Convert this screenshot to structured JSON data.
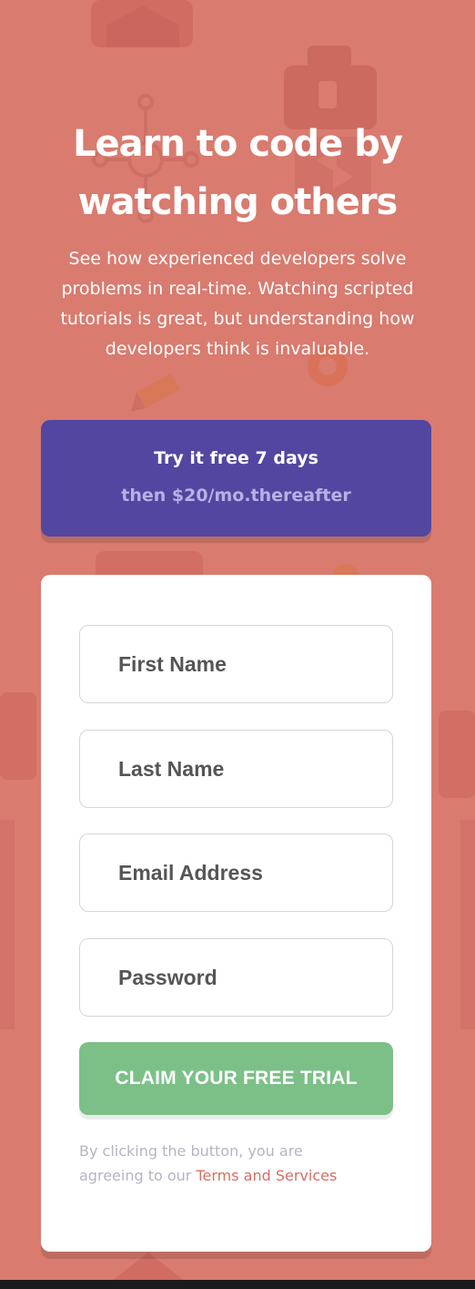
{
  "colors": {
    "background": "#d97b6f",
    "offer_background": "#5346a1",
    "offer_secondary_text": "#b8b0e3",
    "submit_background": "#7cc088",
    "link_color": "#d96c61",
    "legal_text_color": "#b6b3c4"
  },
  "hero": {
    "headline_line1": "Learn to code by",
    "headline_line2": "watching others",
    "intro": "See how experienced developers solve problems in real-time. Watching scripted tutorials is great, but understanding how developers think is invaluable."
  },
  "offer": {
    "main": "Try it free 7 days",
    "sub": "then $20/mo.thereafter"
  },
  "form": {
    "first_name_placeholder": "First Name",
    "last_name_placeholder": "Last Name",
    "email_placeholder": "Email Address",
    "password_placeholder": "Password",
    "submit_label": "CLAIM YOUR FREE TRIAL",
    "legal_prefix": "By clicking the button, you are agreeing to our ",
    "legal_link": "Terms and Services"
  },
  "background_icons": [
    "house-icon",
    "toolbox-icon",
    "network-icon",
    "arrows-icon",
    "gear-icon",
    "pencil-icon",
    "code-icon",
    "bulb-icon"
  ]
}
